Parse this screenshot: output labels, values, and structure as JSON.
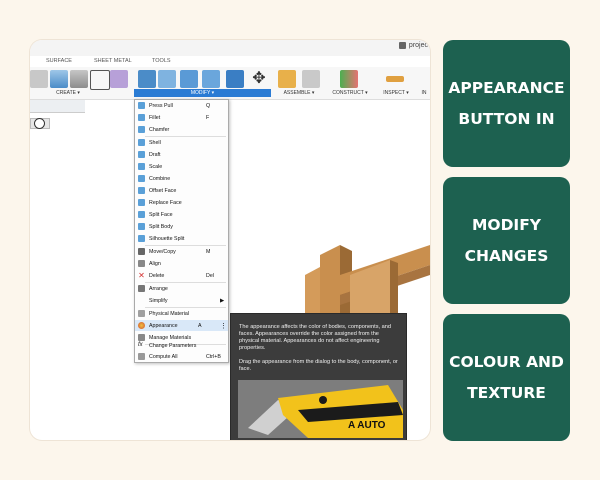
{
  "window": {
    "project_label": "projec"
  },
  "ribbon": {
    "tabs": [
      "SURFACE",
      "SHEET METAL",
      "TOOLS"
    ],
    "groups": [
      "CREATE ▾",
      "MODIFY ▾",
      "ASSEMBLE ▾",
      "CONSTRUCT ▾",
      "INSPECT ▾",
      "IN"
    ]
  },
  "modify_menu": {
    "items": [
      {
        "label": "Press Pull",
        "shortcut": "Q"
      },
      {
        "label": "Fillet",
        "shortcut": "F"
      },
      {
        "label": "Chamfer",
        "shortcut": ""
      },
      {
        "label": "Shell",
        "shortcut": ""
      },
      {
        "label": "Draft",
        "shortcut": ""
      },
      {
        "label": "Scale",
        "shortcut": ""
      },
      {
        "label": "Combine",
        "shortcut": ""
      },
      {
        "label": "Offset Face",
        "shortcut": ""
      },
      {
        "label": "Replace Face",
        "shortcut": ""
      },
      {
        "label": "Split Face",
        "shortcut": ""
      },
      {
        "label": "Split Body",
        "shortcut": ""
      },
      {
        "label": "Silhouette Split",
        "shortcut": ""
      },
      {
        "label": "Move/Copy",
        "shortcut": "M"
      },
      {
        "label": "Align",
        "shortcut": ""
      },
      {
        "label": "Delete",
        "shortcut": "Del"
      },
      {
        "label": "Arrange",
        "shortcut": ""
      },
      {
        "label": "Simplify",
        "shortcut": "▶"
      },
      {
        "label": "Physical Material",
        "shortcut": ""
      },
      {
        "label": "Appearance",
        "shortcut": "A"
      },
      {
        "label": "Manage Materials",
        "shortcut": ""
      },
      {
        "label": "Change Parameters",
        "shortcut": ""
      },
      {
        "label": "Compute All",
        "shortcut": "Ctrl+B"
      }
    ],
    "highlighted": "Appearance"
  },
  "tooltip": {
    "paragraph1": "The appearance affects the color of bodies, components, and faces. Appearances override the color assigned from the physical material. Appearances do not affect engineering properties.",
    "paragraph2": "Drag the appearance from the dialog to the body, component, or face.",
    "image_caption": "A AUTO"
  },
  "cards": [
    {
      "text": "APPEARANCE BUTTON IN"
    },
    {
      "text": "MODIFY CHANGES"
    },
    {
      "text": "COLOUR AND TEXTURE"
    }
  ],
  "colors": {
    "card_bg": "#1d6150",
    "page_bg": "#fcf6ec",
    "highlight": "#d9e8f8",
    "modify_active": "#2a7bd4"
  }
}
